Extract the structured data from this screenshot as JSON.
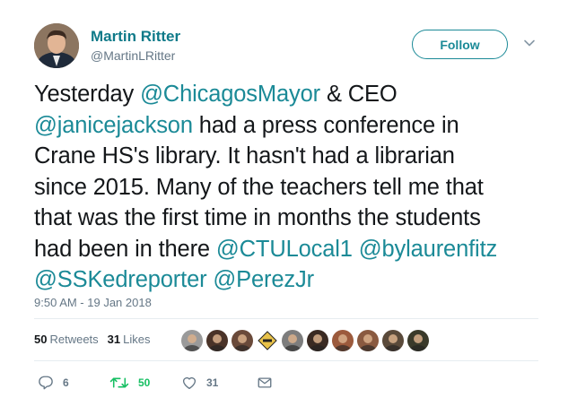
{
  "author": {
    "name": "Martin Ritter",
    "handle": "@MartinLRitter"
  },
  "follow_label": "Follow",
  "tweet_lines": [
    [
      {
        "t": "Yesterday ",
        "m": false
      },
      {
        "t": "@ChicagosMayor",
        "m": true
      },
      {
        "t": " & CEO",
        "m": false
      }
    ],
    [
      {
        "t": "@janicejackson",
        "m": true
      },
      {
        "t": " had a press conference in",
        "m": false
      }
    ],
    [
      {
        "t": "Crane HS's library. It hasn't had a librarian",
        "m": false
      }
    ],
    [
      {
        "t": "since 2015. Many of the teachers tell me that",
        "m": false
      }
    ],
    [
      {
        "t": "that was the first time in months the students",
        "m": false
      }
    ],
    [
      {
        "t": "had been in there ",
        "m": false
      },
      {
        "t": "@CTULocal1",
        "m": true
      },
      {
        "t": " ",
        "m": false
      },
      {
        "t": "@bylaurenfitz",
        "m": true
      }
    ],
    [
      {
        "t": "@SSKedreporter",
        "m": true
      },
      {
        "t": " ",
        "m": false
      },
      {
        "t": "@PerezJr",
        "m": true
      }
    ]
  ],
  "timestamp": "9:50 AM - 19 Jan 2018",
  "stats": {
    "retweets_count": "50",
    "retweets_label": "Retweets",
    "likes_count": "31",
    "likes_label": "Likes"
  },
  "liker_avatars": [
    {
      "name": "liker-avatar-1",
      "color": "#9a9a9a"
    },
    {
      "name": "liker-avatar-2",
      "color": "#4a3328"
    },
    {
      "name": "liker-avatar-3",
      "color": "#6a4a3a"
    },
    {
      "name": "liker-avatar-4",
      "color": "#e8c24a"
    },
    {
      "name": "liker-avatar-5",
      "color": "#7d7d7d"
    },
    {
      "name": "liker-avatar-6",
      "color": "#3a2a22"
    },
    {
      "name": "liker-avatar-7",
      "color": "#9c5a3c"
    },
    {
      "name": "liker-avatar-8",
      "color": "#8a5a40"
    },
    {
      "name": "liker-avatar-9",
      "color": "#5a4a3a"
    },
    {
      "name": "liker-avatar-10",
      "color": "#3a3a2a"
    }
  ],
  "actions": {
    "reply_count": "6",
    "retweet_count": "50",
    "like_count": "31"
  },
  "icons": {
    "reply": "reply-icon",
    "retweet": "retweet-icon",
    "like": "heart-icon",
    "message": "envelope-icon",
    "caret": "chevron-down-icon"
  },
  "colors": {
    "accent": "#1b8a97",
    "retweet_active": "#17bf63",
    "muted": "#657786"
  }
}
